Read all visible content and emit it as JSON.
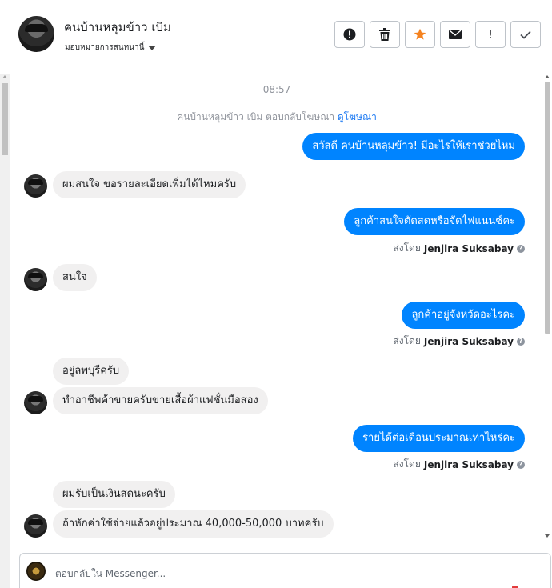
{
  "header": {
    "contact_name": "คนบ้านหลุมข้าว เบิม",
    "assign_label": "มอบหมายการสนทนานี้",
    "actions": [
      {
        "name": "report-button",
        "icon": "alert-circle-icon",
        "label": ""
      },
      {
        "name": "delete-button",
        "icon": "trash-icon",
        "label": ""
      },
      {
        "name": "star-button",
        "icon": "star-icon",
        "label": ""
      },
      {
        "name": "mark-unread-button",
        "icon": "envelope-icon",
        "label": ""
      },
      {
        "name": "follow-up-button",
        "icon": "exclamation-icon",
        "label": "!"
      },
      {
        "name": "mark-done-button",
        "icon": "checkmark-icon",
        "label": ""
      }
    ]
  },
  "chat": {
    "timestamp": "08:57",
    "ad_reply": {
      "text": "คนบ้านหลุมข้าว เบิม ตอบกลับโฆษณา",
      "link": "ดูโฆษณา"
    },
    "messages": [
      {
        "dir": "out",
        "text": "สวัสดี คนบ้านหลุมข้าว! มีอะไรให้เราช่วยไหม"
      },
      {
        "dir": "in",
        "text": "ผมสนใจ ขอรายละเอียดเพิ่มได้ไหมครับ"
      },
      {
        "dir": "out",
        "text": "ลูกค้าสนใจตัดสดหรือจัดไฟแนนซ์คะ"
      },
      {
        "dir": "in",
        "text": "สนใจ"
      },
      {
        "dir": "out",
        "text": "ลูกค้าอยู่จังหวัดอะไรคะ"
      },
      {
        "dir": "in",
        "text": "อยู่ลพบุรีครับ"
      },
      {
        "dir": "in",
        "text": "ทำอาชีพค้าขายครับขายเสื้อผ้าแฟชั่นมือสอง"
      },
      {
        "dir": "out",
        "text": "รายได้ต่อเดือนประมาณเท่าไหร่คะ"
      },
      {
        "dir": "in",
        "text": "ผมรับเป็นเงินสดนะครับ"
      },
      {
        "dir": "in",
        "text": "ถ้าหักค่าใช้จ่ายแล้วอยู่ประมาณ 40,000-50,000 บาทครับ"
      }
    ],
    "sent_by_label": "ส่งโดย",
    "agent_name": "Jenjira Suksabay",
    "help_icon": "?"
  },
  "composer": {
    "placeholder": "ตอบกลับใน Messenger..."
  },
  "colors": {
    "outgoing_bubble": "#0084ff",
    "incoming_bubble": "#f1f0f0",
    "star": "#f5821f",
    "link": "#1877f2"
  }
}
